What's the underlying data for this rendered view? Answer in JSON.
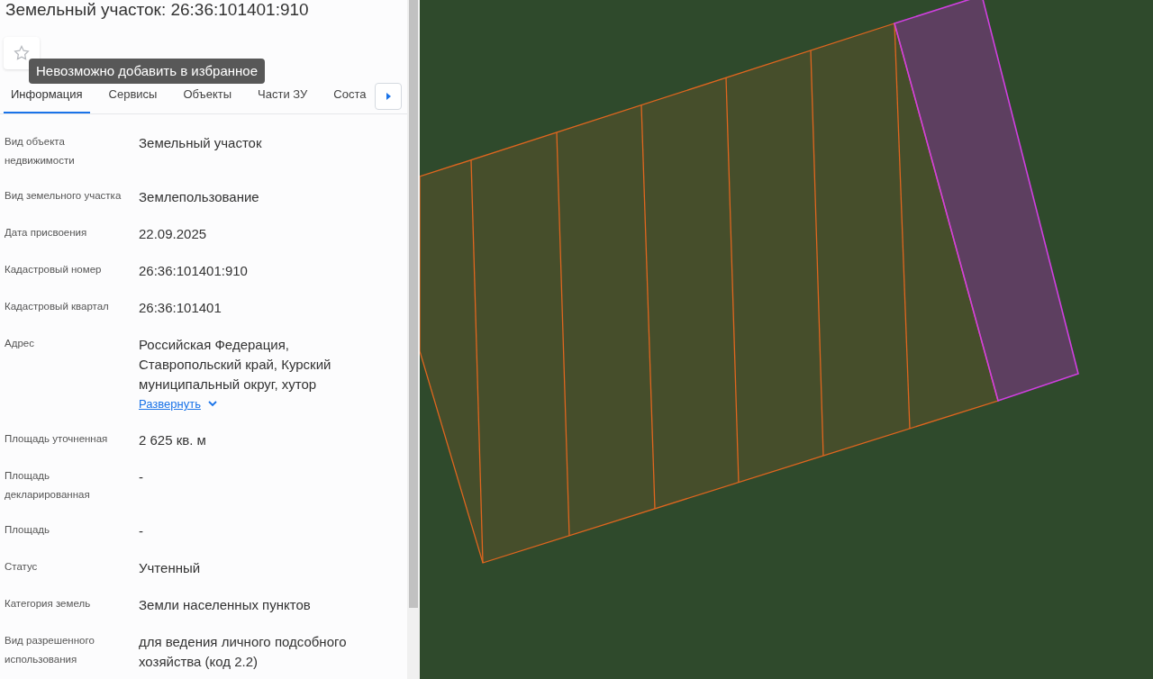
{
  "title": "Земельный участок: 26:36:101401:910",
  "favorite": {
    "on": false
  },
  "tooltip": "Невозможно добавить в избранное",
  "tabs": [
    {
      "label": "Информация",
      "selected": true
    },
    {
      "label": "Сервисы",
      "selected": false
    },
    {
      "label": "Объекты",
      "selected": false
    },
    {
      "label": "Части ЗУ",
      "selected": false
    },
    {
      "label": "Соста",
      "selected": false
    }
  ],
  "rows": [
    {
      "label": "Вид объекта недвижимости",
      "value": "Земельный участок"
    },
    {
      "label": "Вид земельного участка",
      "value": "Землепользование"
    },
    {
      "label": "Дата присвоения",
      "value": "22.09.2025"
    },
    {
      "label": "Кадастровый номер",
      "value": "26:36:101401:910"
    },
    {
      "label": "Кадастровый квартал",
      "value": "26:36:101401"
    },
    {
      "label": "Адрес",
      "value": "Российская Федерация, Ставропольский край, Курский муниципальный округ, хутор",
      "link": "Развернуть"
    },
    {
      "label": "Площадь уточненная",
      "value": "2 625 кв. м"
    },
    {
      "label": "Площадь декларированная",
      "value": "-"
    },
    {
      "label": "Площадь",
      "value": "-"
    },
    {
      "label": "Статус",
      "value": "Учтенный"
    },
    {
      "label": "Категория земель",
      "value": "Земли населенных пунктов"
    },
    {
      "label": "Вид разрешенного использования",
      "value": "для ведения личного подсобного хозяйства (код 2.2)"
    }
  ]
}
